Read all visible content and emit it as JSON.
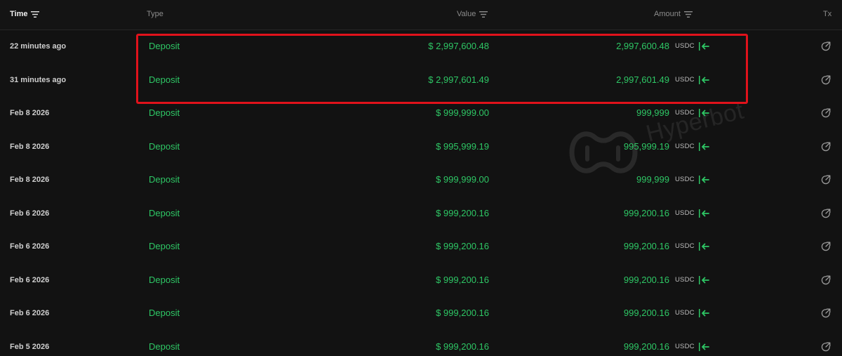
{
  "header": {
    "time": "Time",
    "type": "Type",
    "value": "Value",
    "amount": "Amount",
    "tx": "Tx"
  },
  "watermark": "Hyperbot",
  "colors": {
    "background": "#121212",
    "green": "#2ec765",
    "highlight": "#e0121b"
  },
  "rows": [
    {
      "time": "22 minutes ago",
      "type": "Deposit",
      "value": "$ 2,997,600.48",
      "amount": "2,997,600.48",
      "unit": "USDC"
    },
    {
      "time": "31 minutes ago",
      "type": "Deposit",
      "value": "$ 2,997,601.49",
      "amount": "2,997,601.49",
      "unit": "USDC"
    },
    {
      "time": "Feb 8 2026",
      "type": "Deposit",
      "value": "$ 999,999.00",
      "amount": "999,999",
      "unit": "USDC"
    },
    {
      "time": "Feb 8 2026",
      "type": "Deposit",
      "value": "$ 995,999.19",
      "amount": "995,999.19",
      "unit": "USDC"
    },
    {
      "time": "Feb 8 2026",
      "type": "Deposit",
      "value": "$ 999,999.00",
      "amount": "999,999",
      "unit": "USDC"
    },
    {
      "time": "Feb 6 2026",
      "type": "Deposit",
      "value": "$ 999,200.16",
      "amount": "999,200.16",
      "unit": "USDC"
    },
    {
      "time": "Feb 6 2026",
      "type": "Deposit",
      "value": "$ 999,200.16",
      "amount": "999,200.16",
      "unit": "USDC"
    },
    {
      "time": "Feb 6 2026",
      "type": "Deposit",
      "value": "$ 999,200.16",
      "amount": "999,200.16",
      "unit": "USDC"
    },
    {
      "time": "Feb 6 2026",
      "type": "Deposit",
      "value": "$ 999,200.16",
      "amount": "999,200.16",
      "unit": "USDC"
    },
    {
      "time": "Feb 5 2026",
      "type": "Deposit",
      "value": "$ 999,200.16",
      "amount": "999,200.16",
      "unit": "USDC"
    }
  ],
  "icons": {
    "sort": "filter-lines-icon",
    "direction": "deposit-arrow-icon",
    "tx": "external-link-icon"
  }
}
